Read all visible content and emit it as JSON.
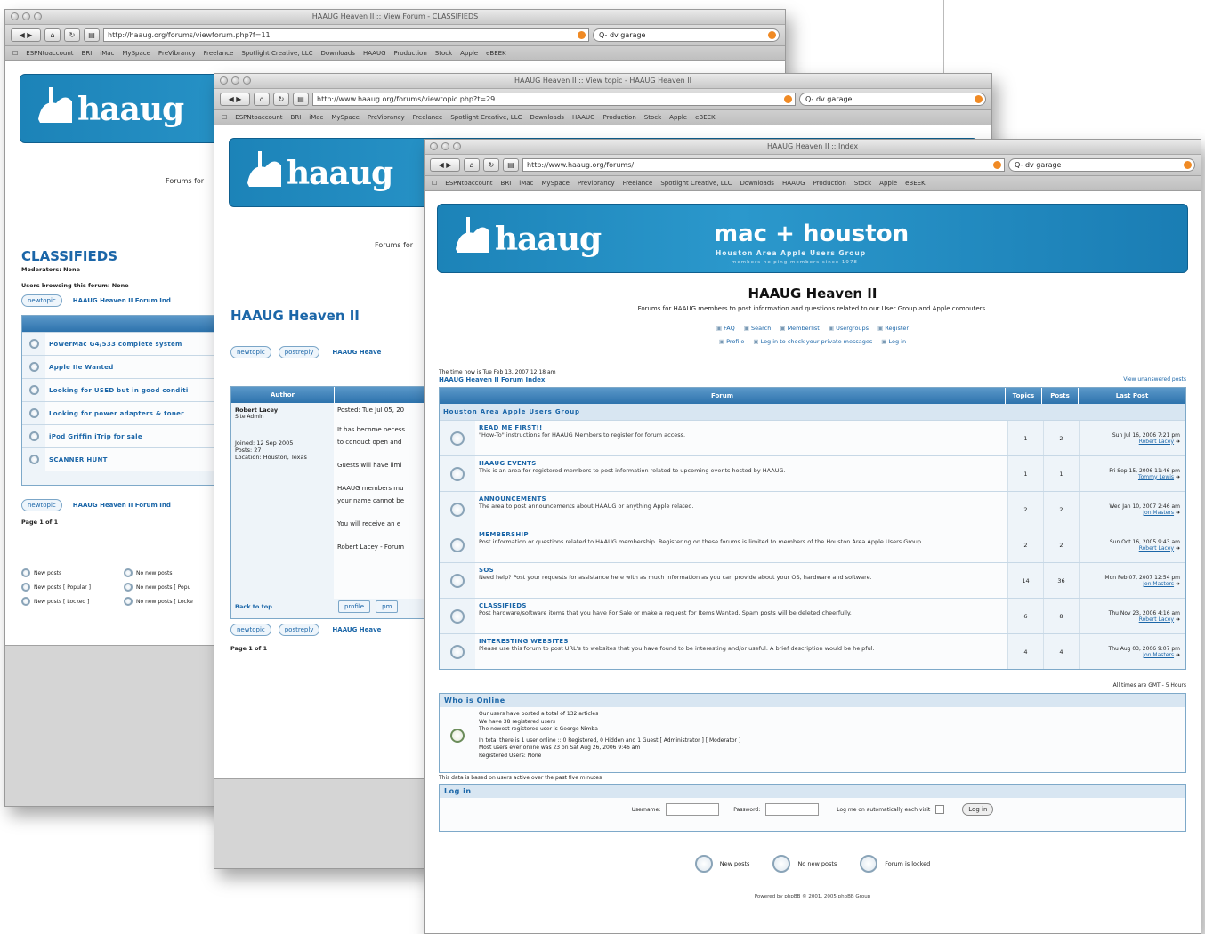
{
  "back": {
    "title": "HAAUG Heaven II :: View Forum - CLASSIFIEDS",
    "url": "http://haaug.org/forums/viewforum.php?f=11",
    "search": "dv garage",
    "forums_for": "Forums for",
    "heading": "CLASSIFIEDS",
    "moderators": "Moderators: None",
    "browsing": "Users browsing this forum: None",
    "newtopic": "newtopic",
    "index_link": "HAAUG Heaven II Forum Ind",
    "topics": [
      "PowerMac G4/533 complete system",
      "Apple IIe Wanted",
      "Looking for USED but in good conditi",
      "Looking for power adapters & toner",
      "iPod Griffin iTrip for sale",
      "SCANNER HUNT"
    ],
    "page": "Page 1 of 1",
    "legend": [
      "New posts",
      "New posts [ Popular ]",
      "New posts [ Locked ]",
      "No new posts",
      "No new posts [ Popu",
      "No new posts [ Locke"
    ]
  },
  "middle": {
    "title": "HAAUG Heaven II :: View topic - HAAUG Heaven II",
    "url": "http://www.haaug.org/forums/viewtopic.php?t=29",
    "search": "dv garage",
    "forums_for": "Forums for",
    "heading": "HAAUG Heaven II",
    "newtopic": "newtopic",
    "postreply": "postreply",
    "index_link": "HAAUG Heave",
    "author_col": "Author",
    "author": "Robert Lacey",
    "role": "Site Admin",
    "joined": "Joined: 12 Sep 2005",
    "posts": "Posts: 27",
    "location": "Location: Houston, Texas",
    "posted": "Posted: Tue Jul 05, 20",
    "lines": [
      "It has become necess",
      "to conduct open and",
      "Guests will have limi",
      "HAAUG members mu",
      "your name cannot be",
      "You will receive an e",
      "Robert Lacey - Forum"
    ],
    "back_to_top": "Back to top",
    "profile": "profile",
    "pm": "pm",
    "page": "Page 1 of 1"
  },
  "front": {
    "title": "HAAUG Heaven II :: Index",
    "url": "http://www.haaug.org/forums/",
    "search": "dv garage",
    "bookmarks": [
      "ESPNtoaccount",
      "BRI",
      "iMac",
      "MySpace",
      "PreVibrancy",
      "Freelance",
      "Spotlight Creative, LLC",
      "Downloads",
      "HAAUG",
      "Production",
      "Stock",
      "Apple",
      "eBEEK"
    ],
    "banner_title": "mac + houston",
    "banner_sub": "Houston Area Apple Users Group",
    "banner_sub2": "members helping members since 1978",
    "logo_word": "haaug",
    "site_title": "HAAUG Heaven II",
    "tagline": "Forums for HAAUG members to post information and questions related to our User Group and Apple computers.",
    "nav1": [
      "FAQ",
      "Search",
      "Memberlist",
      "Usergroups",
      "Register"
    ],
    "nav2": [
      "Profile",
      "Log in to check your private messages",
      "Log in"
    ],
    "time_now": "The time now is Tue Feb 13, 2007 12:18 am",
    "index_link": "HAAUG Heaven II Forum Index",
    "unanswered": "View unanswered posts",
    "columns": [
      "Forum",
      "Topics",
      "Posts",
      "Last Post"
    ],
    "category": "Houston Area Apple Users Group",
    "forums": [
      {
        "name": "READ ME FIRST!!",
        "desc": "\"How-To\" instructions for HAAUG Members to register for forum access.",
        "topics": "1",
        "posts": "2",
        "last": "Sun Jul 16, 2006 7:21 pm",
        "by": "Robert Lacey"
      },
      {
        "name": "HAAUG EVENTS",
        "desc": "This is an area for registered members to post information related to upcoming events hosted by HAAUG.",
        "topics": "1",
        "posts": "1",
        "last": "Fri Sep 15, 2006 11:46 pm",
        "by": "Tommy Lewis"
      },
      {
        "name": "ANNOUNCEMENTS",
        "desc": "The area to post announcements about HAAUG or anything Apple related.",
        "topics": "2",
        "posts": "2",
        "last": "Wed Jan 10, 2007 2:46 am",
        "by": "Jon Masters"
      },
      {
        "name": "MEMBERSHIP",
        "desc": "Post information or questions related to HAAUG membership. Registering on these forums is limited to members of the Houston Area Apple Users Group.",
        "topics": "2",
        "posts": "2",
        "last": "Sun Oct 16, 2005 9:43 am",
        "by": "Robert Lacey"
      },
      {
        "name": "SOS",
        "desc": "Need help? Post your requests for assistance here with as much information as you can provide about your OS, hardware and software.",
        "topics": "14",
        "posts": "36",
        "last": "Mon Feb 07, 2007 12:54 pm",
        "by": "Jon Masters"
      },
      {
        "name": "CLASSIFIEDS",
        "desc": "Post hardware/software items that you have For Sale or make a request for Items Wanted. Spam posts will be deleted cheerfully.",
        "topics": "6",
        "posts": "8",
        "last": "Thu Nov 23, 2006 4:16 am",
        "by": "Robert Lacey"
      },
      {
        "name": "INTERESTING WEBSITES",
        "desc": "Please use this forum to post URL's to websites that you have found to be interesting and/or useful. A brief description would be helpful.",
        "topics": "4",
        "posts": "4",
        "last": "Thu Aug 03, 2006 9:07 pm",
        "by": "Jon Masters"
      }
    ],
    "timezone": "All times are GMT - 5 Hours",
    "online_head": "Who is Online",
    "online_lines": [
      "Our users have posted a total of 132 articles",
      "We have 38 registered users",
      "The newest registered user is George Nimba",
      "In total there is 1 user online :: 0 Registered, 0 Hidden and 1 Guest   [ Administrator ]   [ Moderator ]",
      "Most users ever online was 23 on Sat Aug 26, 2006 9:46 am",
      "Registered Users: None"
    ],
    "online_note": "This data is based on users active over the past five minutes",
    "login_head": "Log in",
    "username_label": "Username:",
    "password_label": "Password:",
    "autologin": "Log me on automatically each visit",
    "login_btn": "Log in",
    "legend": [
      "New posts",
      "No new posts",
      "Forum is locked"
    ],
    "footer": "Powered by phpBB © 2001, 2005 phpBB Group"
  }
}
